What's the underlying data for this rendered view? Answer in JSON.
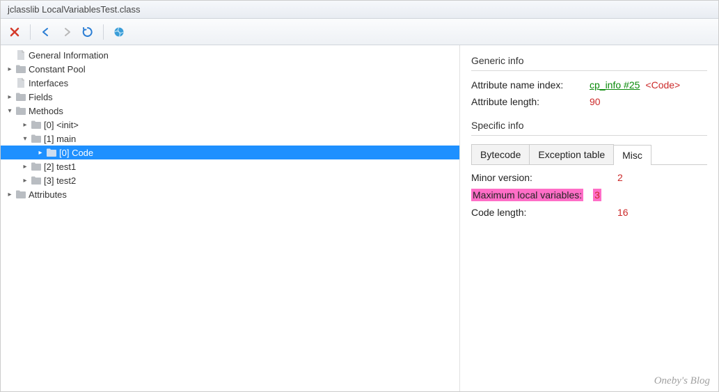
{
  "window": {
    "title": "jclasslib LocalVariablesTest.class"
  },
  "toolbar": {
    "close_icon": "close-icon",
    "back_icon": "back-arrow-icon",
    "forward_icon": "forward-arrow-icon",
    "refresh_icon": "refresh-icon",
    "globe_icon": "globe-icon"
  },
  "tree": [
    {
      "label": "General Information",
      "icon": "file",
      "depth": 0,
      "caret": "none",
      "selected": false,
      "name": "tree-general-information"
    },
    {
      "label": "Constant Pool",
      "icon": "folder",
      "depth": 0,
      "caret": "closed",
      "selected": false,
      "name": "tree-constant-pool"
    },
    {
      "label": "Interfaces",
      "icon": "file",
      "depth": 0,
      "caret": "none",
      "selected": false,
      "name": "tree-interfaces"
    },
    {
      "label": "Fields",
      "icon": "folder",
      "depth": 0,
      "caret": "closed",
      "selected": false,
      "name": "tree-fields"
    },
    {
      "label": "Methods",
      "icon": "folder",
      "depth": 0,
      "caret": "open",
      "selected": false,
      "name": "tree-methods"
    },
    {
      "label": "[0] <init>",
      "icon": "folder",
      "depth": 1,
      "caret": "closed",
      "selected": false,
      "name": "tree-method-0-init"
    },
    {
      "label": "[1] main",
      "icon": "folder",
      "depth": 1,
      "caret": "open",
      "selected": false,
      "name": "tree-method-1-main"
    },
    {
      "label": "[0] Code",
      "icon": "folder",
      "depth": 2,
      "caret": "closed",
      "selected": true,
      "name": "tree-method-1-main-code"
    },
    {
      "label": "[2] test1",
      "icon": "folder",
      "depth": 1,
      "caret": "closed",
      "selected": false,
      "name": "tree-method-2-test1"
    },
    {
      "label": "[3] test2",
      "icon": "folder",
      "depth": 1,
      "caret": "closed",
      "selected": false,
      "name": "tree-method-3-test2"
    },
    {
      "label": "Attributes",
      "icon": "folder",
      "depth": 0,
      "caret": "closed",
      "selected": false,
      "name": "tree-attributes"
    }
  ],
  "detail": {
    "generic_title": "Generic info",
    "attr_name_label": "Attribute name index:",
    "attr_name_link": "cp_info #25",
    "attr_name_tag": "<Code>",
    "attr_len_label": "Attribute length:",
    "attr_len_value": "90",
    "specific_title": "Specific info",
    "tabs": {
      "bytecode": "Bytecode",
      "exception": "Exception table",
      "misc": "Misc"
    },
    "misc": {
      "minor_label": "Minor version:",
      "minor_value": "2",
      "maxlocal_label": "Maximum local variables:",
      "maxlocal_value": "3",
      "codelen_label": "Code length:",
      "codelen_value": "16"
    }
  },
  "watermark": "Oneby's Blog"
}
